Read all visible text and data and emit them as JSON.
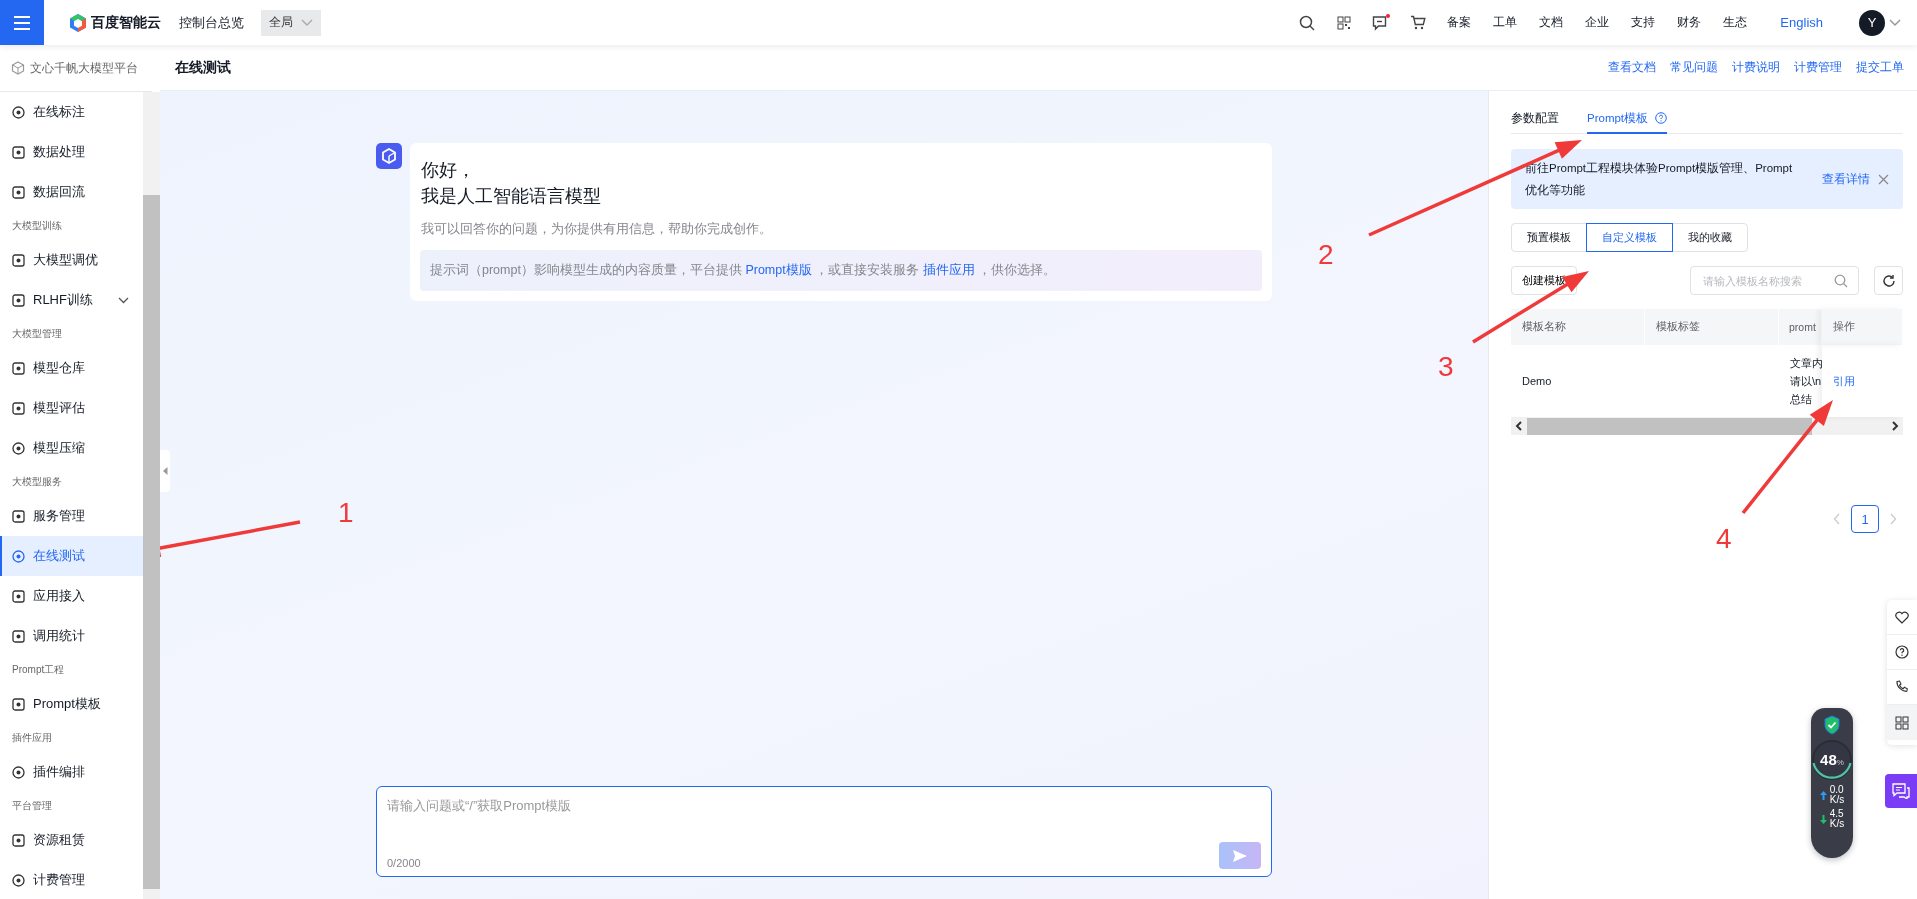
{
  "topbar": {
    "brand": "百度智能云",
    "console": "控制台总览",
    "region": "全局",
    "nav": [
      {
        "kind": "search"
      },
      {
        "kind": "grid"
      },
      {
        "kind": "message",
        "dot": true
      },
      {
        "kind": "cart"
      },
      {
        "kind": "text",
        "label": "备案"
      },
      {
        "kind": "text",
        "label": "工单"
      },
      {
        "kind": "text",
        "label": "文档"
      },
      {
        "kind": "text",
        "label": "企业"
      },
      {
        "kind": "text",
        "label": "支持"
      },
      {
        "kind": "text",
        "label": "财务"
      },
      {
        "kind": "text",
        "label": "生态"
      }
    ],
    "language": "English",
    "avatar": "Y"
  },
  "sidebar": {
    "title": "文心千帆大模型平台",
    "items": [
      {
        "kind": "item",
        "label": "在线标注",
        "selected": false
      },
      {
        "kind": "item",
        "label": "数据处理",
        "selected": false
      },
      {
        "kind": "item",
        "label": "数据回流",
        "selected": false
      },
      {
        "kind": "section",
        "label": "大模型训练"
      },
      {
        "kind": "item",
        "label": "大模型调优",
        "selected": false
      },
      {
        "kind": "item",
        "label": "RLHF训练",
        "selected": false,
        "expanded": false
      },
      {
        "kind": "section",
        "label": "大模型管理"
      },
      {
        "kind": "item",
        "label": "模型仓库",
        "selected": false
      },
      {
        "kind": "item",
        "label": "模型评估",
        "selected": false
      },
      {
        "kind": "item",
        "label": "模型压缩",
        "selected": false
      },
      {
        "kind": "section",
        "label": "大模型服务"
      },
      {
        "kind": "item",
        "label": "服务管理",
        "selected": false
      },
      {
        "kind": "item",
        "label": "在线测试",
        "selected": true
      },
      {
        "kind": "item",
        "label": "应用接入",
        "selected": false
      },
      {
        "kind": "item",
        "label": "调用统计",
        "selected": false
      },
      {
        "kind": "section",
        "label": "Prompt工程"
      },
      {
        "kind": "item",
        "label": "Prompt模板",
        "selected": false
      },
      {
        "kind": "section",
        "label": "插件应用"
      },
      {
        "kind": "item",
        "label": "插件编排",
        "selected": false
      },
      {
        "kind": "section",
        "label": "平台管理"
      },
      {
        "kind": "item",
        "label": "资源租赁",
        "selected": false
      },
      {
        "kind": "item",
        "label": "计费管理",
        "selected": false
      }
    ]
  },
  "page": {
    "title": "在线测试",
    "links": [
      "查看文档",
      "常见问题",
      "计费说明",
      "计费管理",
      "提交工单"
    ]
  },
  "chat": {
    "greeting": [
      "你好，",
      "我是人工智能语言模型"
    ],
    "intro": "我可以回答你的问题，为你提供有用信息，帮助你完成创作。",
    "tip": [
      {
        "kind": "text",
        "text": "提示词（prompt）影响模型生成的内容质量，平台提供 "
      },
      {
        "kind": "link",
        "text": "Prompt模版"
      },
      {
        "kind": "text",
        "text": " ，或直接安装服务 "
      },
      {
        "kind": "link",
        "text": "插件应用"
      },
      {
        "kind": "text",
        "text": " ，供你选择。"
      }
    ],
    "input": {
      "placeholder": "请输入问题或“/”获取Prompt模版",
      "counter": "0/2000",
      "send_disabled": true
    }
  },
  "panel": {
    "tabs": [
      {
        "label": "参数配置",
        "selected": false
      },
      {
        "label": "Prompt模板",
        "selected": true,
        "help": true
      }
    ],
    "notice": {
      "text": "前往Prompt工程模块体验Prompt模版管理、Prompt优化等功能",
      "link": "查看详情"
    },
    "segments": [
      {
        "label": "预置模板",
        "selected": false
      },
      {
        "label": "自定义模板",
        "selected": true
      },
      {
        "label": "我的收藏",
        "selected": false
      }
    ],
    "create_button": "创建模板",
    "search": {
      "placeholder": "请输入模板名称搜索"
    },
    "table": {
      "columns": [
        "模板名称",
        "模板标签",
        "promt",
        "操作"
      ],
      "rows": [
        {
          "name": "Demo",
          "prompt_lines": [
            "文章内",
            "请以\\n",
            "总结"
          ],
          "action": "引用"
        }
      ]
    },
    "pagination": {
      "pages": [
        {
          "label": "1",
          "selected": true
        }
      ]
    }
  },
  "monitor": {
    "percent": "48",
    "unit": "%",
    "up": "0.0",
    "up_unit": "K/s",
    "down": "4.5",
    "down_unit": "K/s"
  },
  "annotations": [
    {
      "label": "1"
    },
    {
      "label": "2"
    },
    {
      "label": "3"
    },
    {
      "label": "4"
    }
  ]
}
